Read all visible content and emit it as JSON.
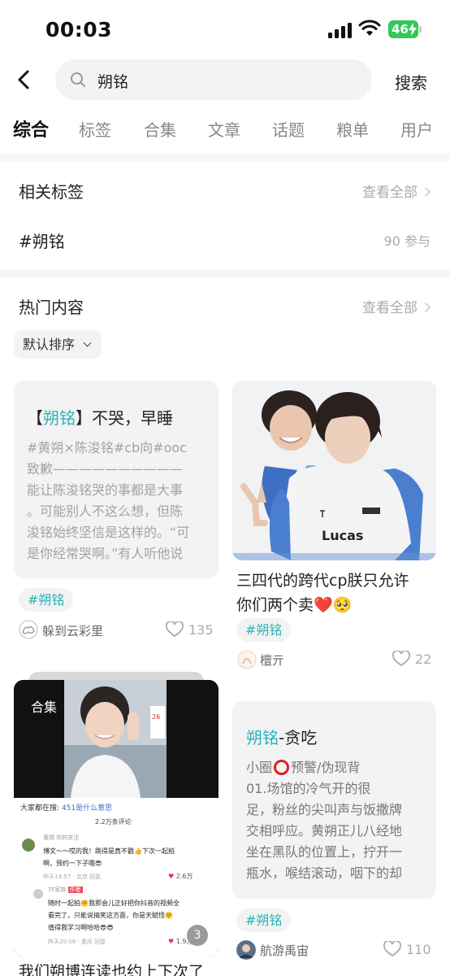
{
  "status_bar": {
    "time": "00:03",
    "battery": "46"
  },
  "search": {
    "query": "朔铭",
    "button": "搜索"
  },
  "tabs": [
    "综合",
    "标签",
    "合集",
    "文章",
    "话题",
    "粮单",
    "用户"
  ],
  "related_tags": {
    "title": "相关标签",
    "view_all": "查看全部",
    "tag": "#朔铭",
    "count": "90 参与"
  },
  "hot": {
    "title": "热门内容",
    "view_all": "查看全部",
    "sort": "默认排序"
  },
  "cards": [
    {
      "title_highlight": "朔铭",
      "title_prefix": "【",
      "title_suffix": "】不哭，早睡",
      "body": [
        "#黄朔×陈浚铭#cb向#ooc",
        "致歉——————————",
        "能让陈浚铭哭的事都是大事",
        "。可能别人不这么想，但陈",
        "浚铭始终坚信是这样的。“可",
        "是你经常哭啊。”有人听他说"
      ],
      "tag": "#朔铭",
      "author": "躲到云彩里",
      "likes": "135"
    },
    {
      "image_caption": "Lucas",
      "post_title_lines": [
        "三四代的跨代cp朕只允许",
        "你们两个卖❤️🥺"
      ],
      "tag": "#朔铭",
      "author": "檀亓",
      "likes": "22"
    },
    {
      "badge": "合集",
      "page_count": "3",
      "post_title": "我们朔博连读也约上下次了",
      "screenshot": {
        "search_label": "大家都在搜:",
        "search_term": "451是什么意思",
        "comment_count": "2.2万条评论",
        "c1_user": "黄朔",
        "c1_tag": "你的关注",
        "c1_text_1": "博文～～哎的我！跳得是真不戳👍下次一起拍",
        "c1_text_2": "啊，预约一下子哦😎",
        "c1_meta": "昨天19:57 · 北京  回复",
        "c1_likes": "2.6万",
        "c2_user": "TF家族",
        "c2_tag": "作者",
        "c2_text_1": "随时一起拍🤗我那会儿正好把你抖音的视频全",
        "c2_text_2": "看完了，只能说搞笑这方面，你是天赋怪🤗",
        "c2_text_3": "值得我学习啊哈哈😎😎",
        "c2_meta": "昨天20:08 · 重庆  回复",
        "c2_likes": "1.9万"
      }
    },
    {
      "title_highlight": "朔铭",
      "title_suffix": "-贪吃",
      "body_first_prefix": "小圈",
      "body_first_suffix": "预警/伪现背",
      "body": [
        "     01.场馆的冷气开的很",
        "足，粉丝的尖叫声与饭撒牌",
        "交相呼应。黄朔正儿八经地",
        "坐在黑队的位置上，拧开一",
        "瓶水，喉结滚动，咽下的却"
      ],
      "tag": "#朔铭",
      "author": "航游禹宙",
      "likes": "110"
    }
  ]
}
